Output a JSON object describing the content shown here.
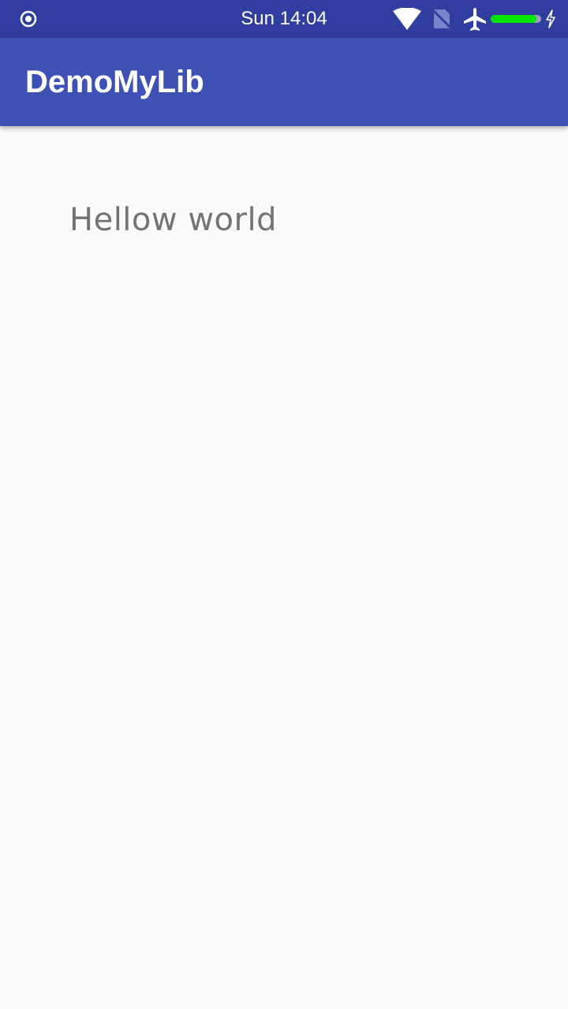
{
  "status_bar": {
    "time": "Sun 14:04",
    "icons": [
      "target-icon",
      "wifi-icon",
      "no-sim-icon",
      "airplane-icon",
      "battery-icon",
      "charging-icon"
    ],
    "battery_level": 0.9,
    "colors": {
      "background": "#303f9f",
      "battery_fill": "#00e600"
    }
  },
  "app_bar": {
    "title": "DemoMyLib",
    "color": "#3f51b5"
  },
  "content": {
    "text": "Hellow world",
    "text_color": "#737373",
    "background": "#fafafa"
  }
}
